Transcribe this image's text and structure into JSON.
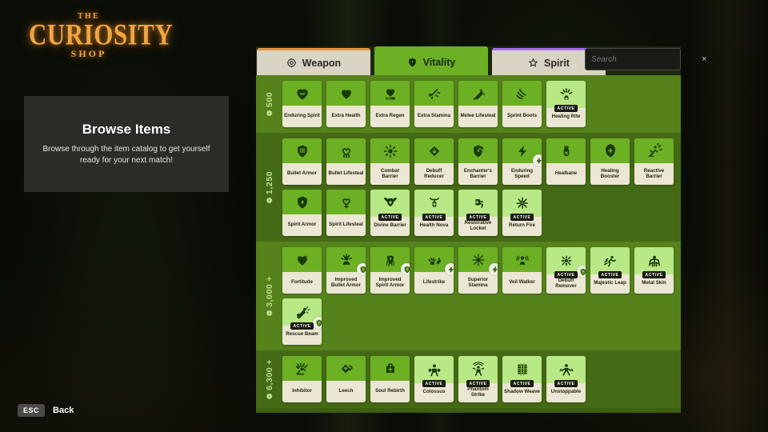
{
  "logo": {
    "the": "THE",
    "main": "CURIOSITY",
    "shop": "SHOP"
  },
  "info_panel": {
    "title": "Browse Items",
    "subtitle": "Browse through the item catalog to get yourself ready for your next match!"
  },
  "footer": {
    "key": "ESC",
    "label": "Back"
  },
  "search": {
    "placeholder": "Search",
    "value": "",
    "clear": "×"
  },
  "tabs": [
    {
      "label": "Weapon",
      "icon": "weapon-target-icon",
      "accent": "#e8913a",
      "active": false
    },
    {
      "label": "Vitality",
      "icon": "vitality-shield-icon",
      "accent": "#6cb023",
      "active": true
    },
    {
      "label": "Spirit",
      "icon": "spirit-star-icon",
      "accent": "#a66cf0",
      "active": false
    }
  ],
  "colors": {
    "panel_bg": "#1d2612",
    "grid_bg": "#3e6011",
    "tier_shade_a": "#55821b",
    "tier_shade_b": "#456a15",
    "card_icon_green": "#6cb023",
    "card_icon_active_green": "#b9e887",
    "card_label_cream": "#ece6d4",
    "tier_label_green": "#b9e08a",
    "logo_orange": "#f0a544"
  },
  "tiers": [
    {
      "price": "500",
      "price_suffix": "",
      "shade": "a",
      "items": [
        {
          "name": "Enduring Spirit",
          "icon": "enduring-spirit-icon",
          "active": false,
          "upgrade": false
        },
        {
          "name": "Extra Health",
          "icon": "extra-health-icon",
          "active": false,
          "upgrade": false
        },
        {
          "name": "Extra Regen",
          "icon": "extra-regen-icon",
          "active": false,
          "upgrade": false
        },
        {
          "name": "Extra Stamina",
          "icon": "extra-stamina-icon",
          "active": false,
          "upgrade": false
        },
        {
          "name": "Melee Lifesteal",
          "icon": "melee-lifesteal-icon",
          "active": false,
          "upgrade": false
        },
        {
          "name": "Sprint Boots",
          "icon": "sprint-boots-icon",
          "active": false,
          "upgrade": false
        },
        {
          "name": "Healing Rite",
          "icon": "healing-rite-icon",
          "active": true,
          "upgrade": false
        }
      ]
    },
    {
      "price": "1,250",
      "price_suffix": "",
      "shade": "b",
      "items": [
        {
          "name": "Bullet Armor",
          "icon": "bullet-armor-icon",
          "active": false,
          "upgrade": false
        },
        {
          "name": "Bullet Lifesteal",
          "icon": "bullet-lifesteal-icon",
          "active": false,
          "upgrade": false
        },
        {
          "name": "Combat Barrier",
          "icon": "combat-barrier-icon",
          "active": false,
          "upgrade": false
        },
        {
          "name": "Debuff Reducer",
          "icon": "debuff-reducer-icon",
          "active": false,
          "upgrade": false
        },
        {
          "name": "Enchanter's Barrier",
          "icon": "enchanters-barrier-icon",
          "active": false,
          "upgrade": false
        },
        {
          "name": "Enduring Speed",
          "icon": "enduring-speed-icon",
          "active": false,
          "upgrade": true
        },
        {
          "name": "Healbane",
          "icon": "healbane-icon",
          "active": false,
          "upgrade": false
        },
        {
          "name": "Healing Booster",
          "icon": "healing-booster-icon",
          "active": false,
          "upgrade": false
        },
        {
          "name": "Reactive Barrier",
          "icon": "reactive-barrier-icon",
          "active": false,
          "upgrade": false
        },
        {
          "name": "Spirit Armor",
          "icon": "spirit-armor-icon",
          "active": false,
          "upgrade": false
        },
        {
          "name": "Spirit Lifesteal",
          "icon": "spirit-lifesteal-icon",
          "active": false,
          "upgrade": false
        },
        {
          "name": "Divine Barrier",
          "icon": "divine-barrier-icon",
          "active": true,
          "upgrade": false
        },
        {
          "name": "Health Nova",
          "icon": "health-nova-icon",
          "active": true,
          "upgrade": false
        },
        {
          "name": "Restorative Locket",
          "icon": "restorative-locket-icon",
          "active": true,
          "upgrade": false
        },
        {
          "name": "Return Fire",
          "icon": "return-fire-icon",
          "active": true,
          "upgrade": false
        }
      ]
    },
    {
      "price": "3,000",
      "price_suffix": "+",
      "shade": "a",
      "items": [
        {
          "name": "Fortitude",
          "icon": "fortitude-icon",
          "active": false,
          "upgrade": false
        },
        {
          "name": "Improved Bullet Armor",
          "icon": "improved-bullet-armor-icon",
          "active": false,
          "upgrade": true
        },
        {
          "name": "Improved Spirit Armor",
          "icon": "improved-spirit-armor-icon",
          "active": false,
          "upgrade": true
        },
        {
          "name": "Lifestrike",
          "icon": "lifestrike-icon",
          "active": false,
          "upgrade": true
        },
        {
          "name": "Superior Stamina",
          "icon": "superior-stamina-icon",
          "active": false,
          "upgrade": true
        },
        {
          "name": "Veil Walker",
          "icon": "veil-walker-icon",
          "active": false,
          "upgrade": false
        },
        {
          "name": "Debuff Remover",
          "icon": "debuff-remover-icon",
          "active": true,
          "upgrade": true
        },
        {
          "name": "Majestic Leap",
          "icon": "majestic-leap-icon",
          "active": true,
          "upgrade": false
        },
        {
          "name": "Metal Skin",
          "icon": "metal-skin-icon",
          "active": true,
          "upgrade": false
        },
        {
          "name": "Rescue Beam",
          "icon": "rescue-beam-icon",
          "active": true,
          "upgrade": true
        }
      ]
    },
    {
      "price": "6,300",
      "price_suffix": "+",
      "shade": "b",
      "items": [
        {
          "name": "Inhibitor",
          "icon": "inhibitor-icon",
          "active": false,
          "upgrade": false
        },
        {
          "name": "Leech",
          "icon": "leech-icon",
          "active": false,
          "upgrade": false
        },
        {
          "name": "Soul Rebirth",
          "icon": "soul-rebirth-icon",
          "active": false,
          "upgrade": false
        },
        {
          "name": "Colossus",
          "icon": "colossus-icon",
          "active": true,
          "upgrade": false
        },
        {
          "name": "Phantom Strike",
          "icon": "phantom-strike-icon",
          "active": true,
          "upgrade": false
        },
        {
          "name": "Shadow Weave",
          "icon": "shadow-weave-icon",
          "active": true,
          "upgrade": false
        },
        {
          "name": "Unstoppable",
          "icon": "unstoppable-icon",
          "active": true,
          "upgrade": false
        }
      ]
    }
  ],
  "labels": {
    "active_badge": "ACTIVE",
    "currency_symbol": "❁"
  }
}
